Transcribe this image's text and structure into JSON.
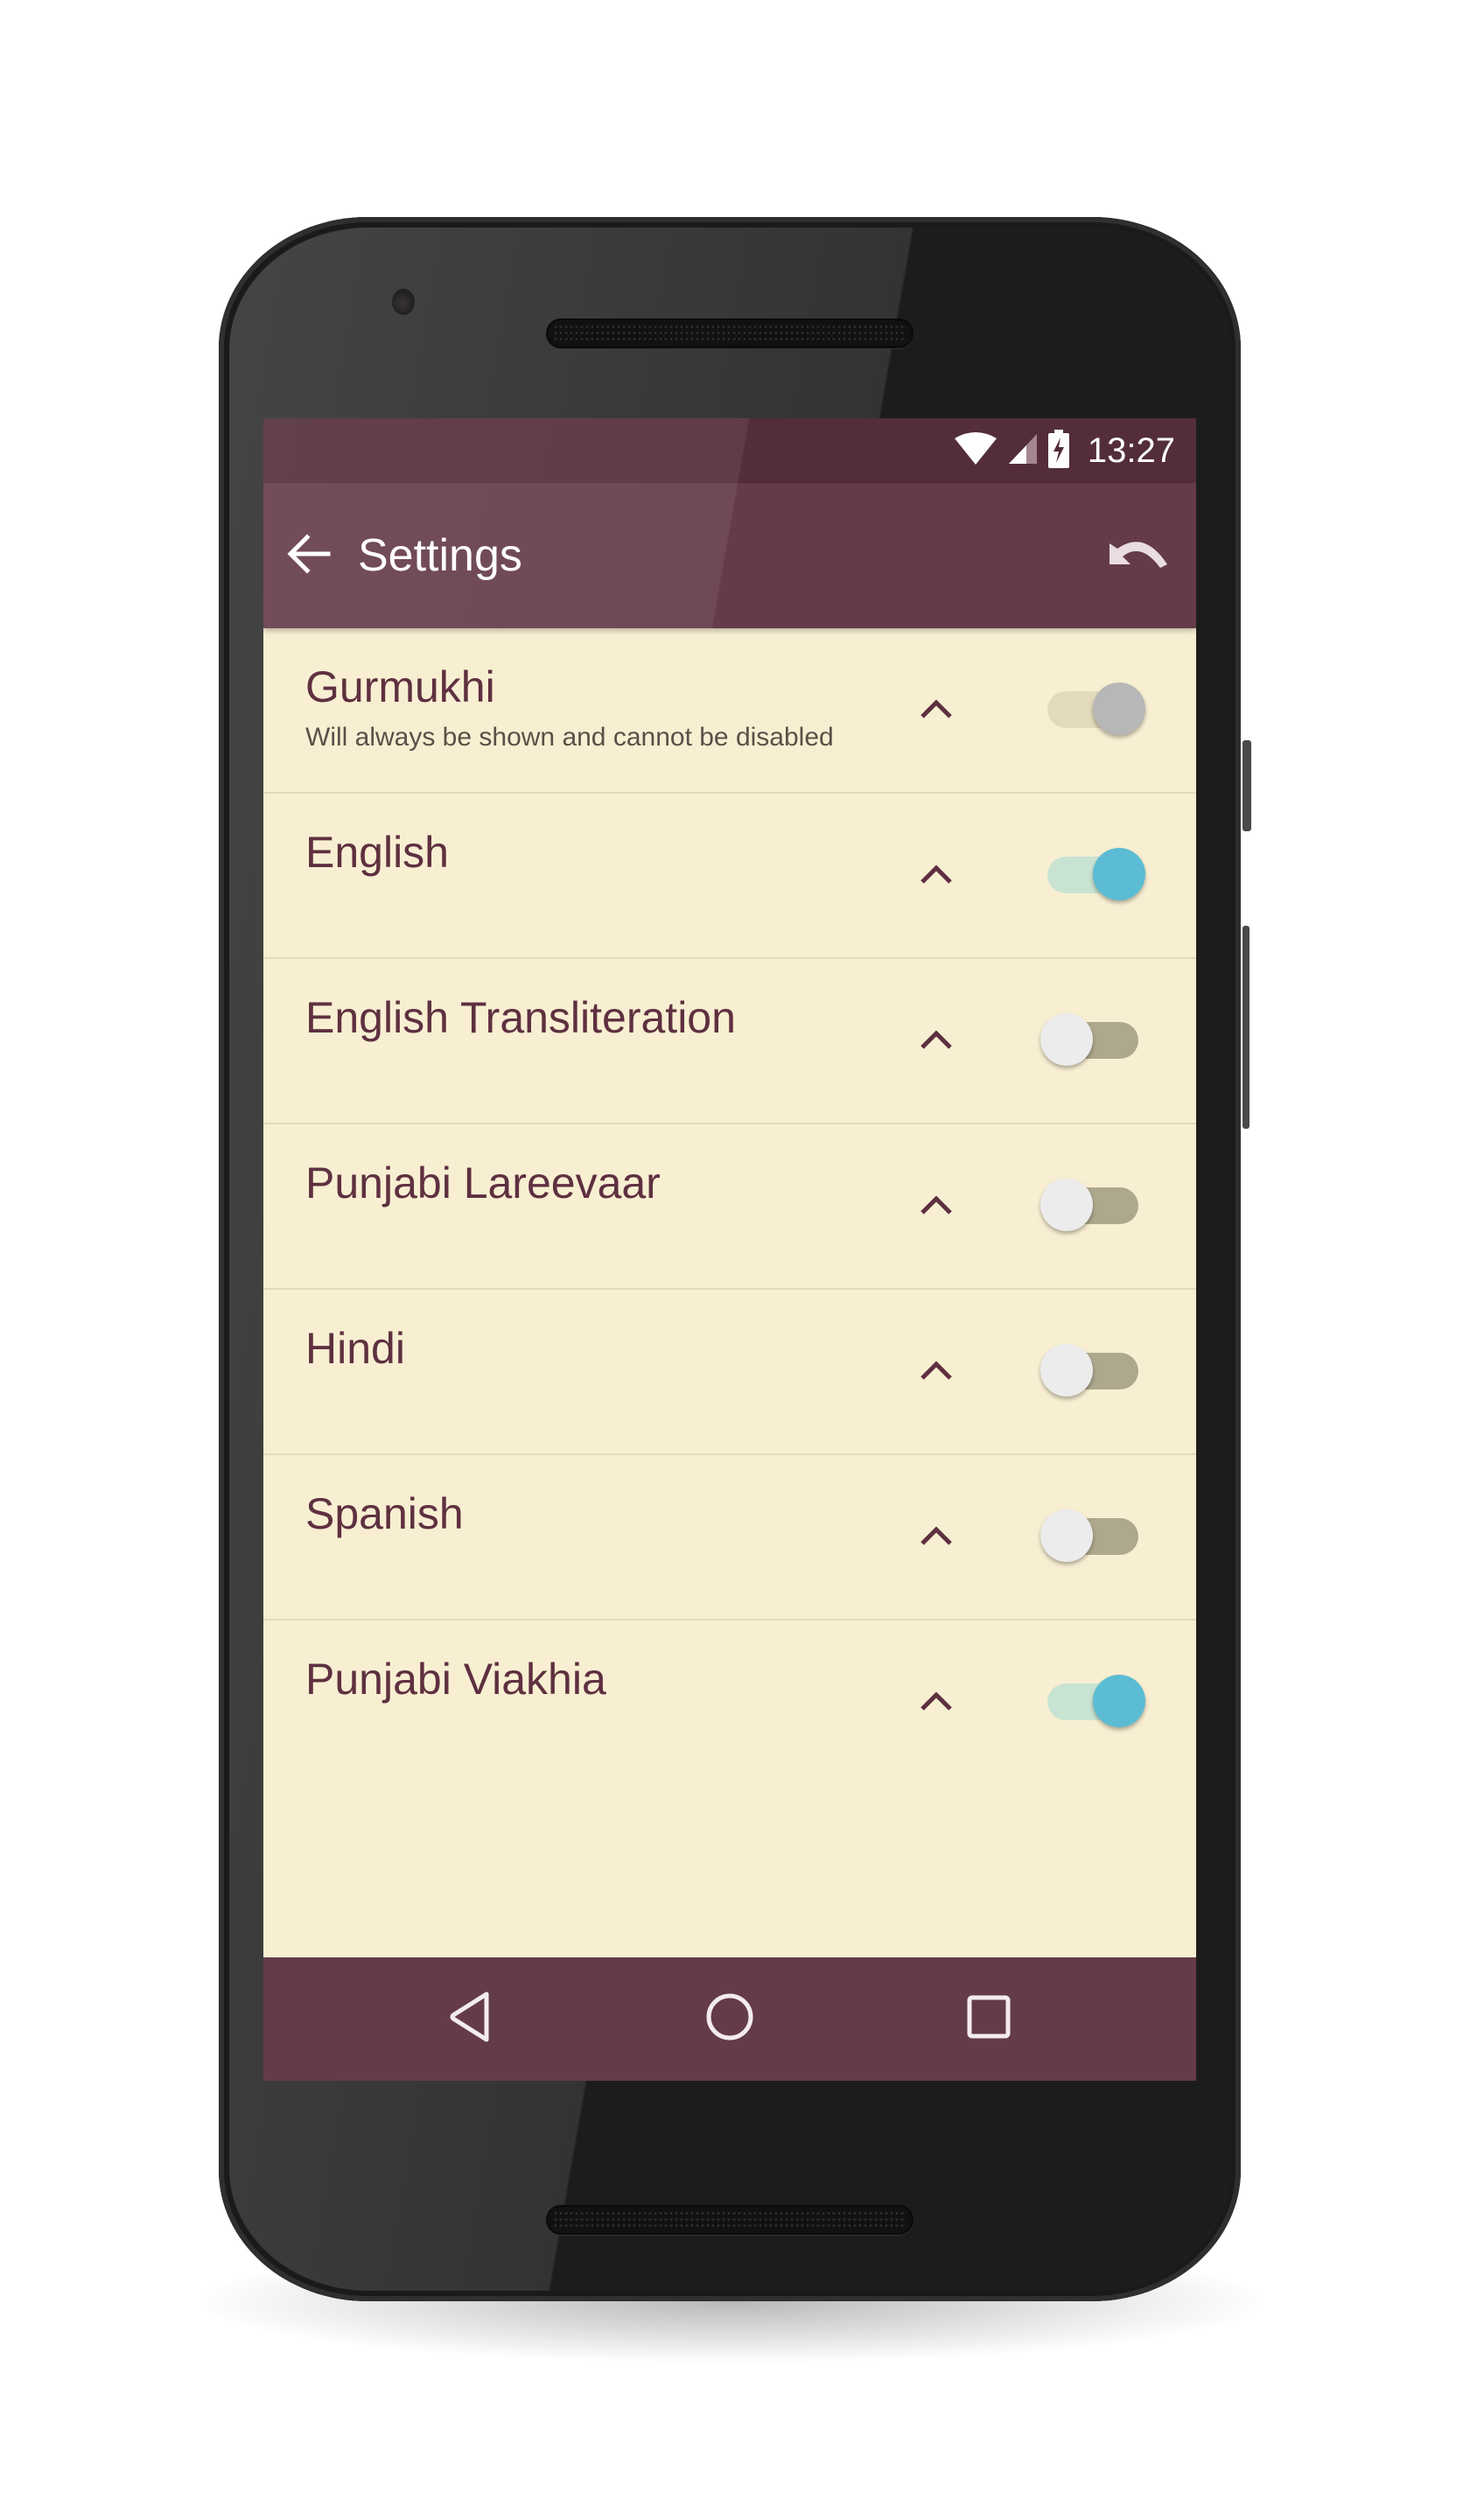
{
  "status_bar": {
    "time": "13:27",
    "icons": [
      "wifi-icon",
      "cellular-signal-icon",
      "battery-charging-icon"
    ]
  },
  "toolbar": {
    "title": "Settings",
    "back_icon": "arrow-back-icon",
    "undo_icon": "undo-icon"
  },
  "settings": {
    "items": [
      {
        "label": "Gurmukhi",
        "subtitle": "Will always be shown and cannot be disabled",
        "enabled": true,
        "disabled_control": true,
        "expand_icon": "chevron-up-icon"
      },
      {
        "label": "English",
        "subtitle": "",
        "enabled": true,
        "disabled_control": false,
        "expand_icon": "chevron-up-icon"
      },
      {
        "label": "English Transliteration",
        "subtitle": "",
        "enabled": false,
        "disabled_control": false,
        "expand_icon": "chevron-up-icon"
      },
      {
        "label": "Punjabi Lareevaar",
        "subtitle": "",
        "enabled": false,
        "disabled_control": false,
        "expand_icon": "chevron-up-icon"
      },
      {
        "label": "Hindi",
        "subtitle": "",
        "enabled": false,
        "disabled_control": false,
        "expand_icon": "chevron-up-icon"
      },
      {
        "label": "Spanish",
        "subtitle": "",
        "enabled": false,
        "disabled_control": false,
        "expand_icon": "chevron-up-icon"
      },
      {
        "label": "Punjabi Viakhia",
        "subtitle": "",
        "enabled": true,
        "disabled_control": false,
        "expand_icon": "chevron-up-icon"
      }
    ]
  },
  "nav_bar": {
    "buttons": [
      "back-triangle-icon",
      "home-circle-icon",
      "recents-square-icon"
    ]
  },
  "colors": {
    "primary": "#643b48",
    "primary_dark": "#532d3a",
    "background": "#f8efd2",
    "text_primary": "#5e3040",
    "text_secondary": "#5a5048",
    "accent": "#5bbcd3",
    "accent_track": "#c9e3d3",
    "switch_off_thumb": "#ececec",
    "switch_off_track": "#ada88e",
    "switch_disabled_thumb": "#b7b7b7",
    "switch_disabled_track": "#e3dabb"
  }
}
